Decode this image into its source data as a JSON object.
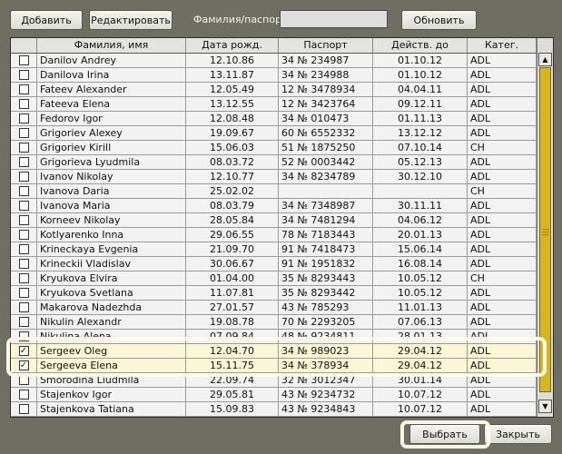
{
  "toolbar": {
    "add_label": "Добавить",
    "edit_label": "Редактировать",
    "search_label": "Фамилия/паспорт",
    "search_value": "",
    "refresh_label": "Обновить"
  },
  "table": {
    "columns": [
      "",
      "Фамилия, имя",
      "Дата рожд.",
      "Паспорт",
      "Действ. до",
      "Катег."
    ],
    "rows": [
      {
        "checked": false,
        "name": "Danilov Andrey",
        "dob": "12.10.86",
        "passport": "34 № 234987",
        "valid": "01.10.12",
        "cat": "ADL"
      },
      {
        "checked": false,
        "name": "Danilova Irina",
        "dob": "13.11.87",
        "passport": "34 № 234988",
        "valid": "01.10.12",
        "cat": "ADL"
      },
      {
        "checked": false,
        "name": "Fateev Alexander",
        "dob": "12.05.49",
        "passport": "12 № 3478934",
        "valid": "04.04.11",
        "cat": "ADL"
      },
      {
        "checked": false,
        "name": "Fateeva Elena",
        "dob": "13.12.55",
        "passport": "12 № 3423764",
        "valid": "09.12.11",
        "cat": "ADL"
      },
      {
        "checked": false,
        "name": "Fedorov Igor",
        "dob": "12.08.48",
        "passport": "34 № 010473",
        "valid": "01.11.13",
        "cat": "ADL"
      },
      {
        "checked": false,
        "name": "Grigoriev Alexey",
        "dob": "19.09.67",
        "passport": "60 № 6552332",
        "valid": "13.12.12",
        "cat": "ADL"
      },
      {
        "checked": false,
        "name": "Grigoriev Kirill",
        "dob": "15.06.03",
        "passport": "51 № 1875250",
        "valid": "07.10.14",
        "cat": "CH"
      },
      {
        "checked": false,
        "name": "Grigorieva Lyudmila",
        "dob": "08.03.72",
        "passport": "52 № 0003442",
        "valid": "05.12.13",
        "cat": "ADL"
      },
      {
        "checked": false,
        "name": "Ivanov Nikolay",
        "dob": "12.10.77",
        "passport": "34 № 8234789",
        "valid": "30.12.10",
        "cat": "ADL"
      },
      {
        "checked": false,
        "name": "Ivanova Daria",
        "dob": "25.02.02",
        "passport": "",
        "valid": "",
        "cat": "CH"
      },
      {
        "checked": false,
        "name": "Ivanova Maria",
        "dob": "08.03.79",
        "passport": "34 № 7348987",
        "valid": "30.11.11",
        "cat": "ADL"
      },
      {
        "checked": false,
        "name": "Korneev Nikolay",
        "dob": "28.05.84",
        "passport": "34 № 7481294",
        "valid": "04.06.12",
        "cat": "ADL"
      },
      {
        "checked": false,
        "name": "Kotlyarenko Inna",
        "dob": "29.06.55",
        "passport": "78 № 7183443",
        "valid": "20.01.13",
        "cat": "ADL"
      },
      {
        "checked": false,
        "name": "Krineckaya Evgenia",
        "dob": "21.09.70",
        "passport": "91 № 7418473",
        "valid": "15.06.14",
        "cat": "ADL"
      },
      {
        "checked": false,
        "name": "Krineckii Vladislav",
        "dob": "30.06.67",
        "passport": "91 № 1951832",
        "valid": "16.08.14",
        "cat": "ADL"
      },
      {
        "checked": false,
        "name": "Kryukova Elvira",
        "dob": "01.04.00",
        "passport": "35 № 8293443",
        "valid": "10.05.12",
        "cat": "CH"
      },
      {
        "checked": false,
        "name": "Kryukova Svetlana",
        "dob": "11.07.81",
        "passport": "35 № 8293442",
        "valid": "10.05.12",
        "cat": "ADL"
      },
      {
        "checked": false,
        "name": "Makarova Nadezhda",
        "dob": "27.01.57",
        "passport": "43 № 785293",
        "valid": "11.01.13",
        "cat": "ADL"
      },
      {
        "checked": false,
        "name": "Nikulin Alexandr",
        "dob": "19.08.78",
        "passport": "70 № 2293205",
        "valid": "07.06.13",
        "cat": "ADL"
      },
      {
        "checked": false,
        "name": "Nikulina Alena",
        "dob": "07.09.84",
        "passport": "48 № 9234811",
        "valid": "28.01.13",
        "cat": "ADL"
      },
      {
        "checked": true,
        "name": "Sergeev Oleg",
        "dob": "12.04.70",
        "passport": "34 № 989023",
        "valid": "29.04.12",
        "cat": "ADL"
      },
      {
        "checked": true,
        "name": "Sergeeva Elena",
        "dob": "15.11.75",
        "passport": "34 № 378934",
        "valid": "29.04.12",
        "cat": "ADL"
      },
      {
        "checked": false,
        "name": "Smorodina Liudmila",
        "dob": "22.09.74",
        "passport": "32 № 3012347",
        "valid": "30.01.14",
        "cat": "ADL"
      },
      {
        "checked": false,
        "name": "Stajenkov Igor",
        "dob": "29.05.81",
        "passport": "43 № 9234732",
        "valid": "10.07.12",
        "cat": "ADL"
      },
      {
        "checked": false,
        "name": "Stajenkova Tatiana",
        "dob": "15.09.83",
        "passport": "43 № 9234843",
        "valid": "10.07.12",
        "cat": "ADL"
      }
    ]
  },
  "footer": {
    "select_label": "Выбрать",
    "close_label": "Закрыть"
  },
  "colors": {
    "background": "#6f6e63",
    "selected_row": "#fbf6d3",
    "scroll_thumb": "#d7b51e"
  }
}
